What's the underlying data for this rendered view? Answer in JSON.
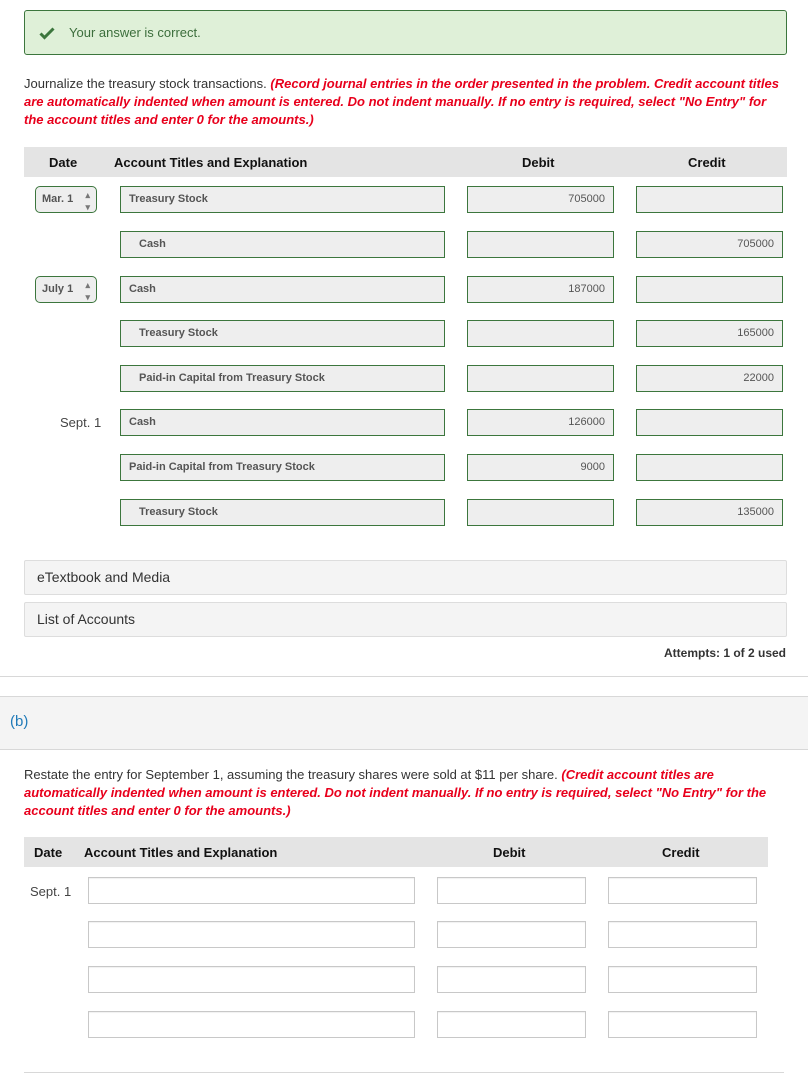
{
  "alert": {
    "icon": "check-icon",
    "message": "Your answer is correct."
  },
  "part_a": {
    "instruction": "Journalize the treasury stock transactions.",
    "instruction_red": "(Record journal entries in the order presented in the problem. Credit account titles are automatically indented when amount is entered. Do not indent manually. If no entry is required, select \"No Entry\" for the account titles and enter 0 for the amounts.)",
    "headers": {
      "date": "Date",
      "account": "Account Titles and Explanation",
      "debit": "Debit",
      "credit": "Credit"
    },
    "rows": [
      {
        "date": "Mar. 1",
        "date_type": "select",
        "account": "Treasury Stock",
        "indent": false,
        "debit": "705000",
        "credit": ""
      },
      {
        "date": "",
        "account": "Cash",
        "indent": true,
        "debit": "",
        "credit": "705000"
      },
      {
        "date": "July 1",
        "date_type": "select",
        "account": "Cash",
        "indent": false,
        "debit": "187000",
        "credit": ""
      },
      {
        "date": "",
        "account": "Treasury Stock",
        "indent": true,
        "debit": "",
        "credit": "165000"
      },
      {
        "date": "",
        "account": "Paid-in Capital from Treasury Stock",
        "indent": true,
        "debit": "",
        "credit": "22000"
      },
      {
        "date": "Sept. 1",
        "date_type": "label",
        "account": "Cash",
        "indent": false,
        "debit": "126000",
        "credit": ""
      },
      {
        "date": "",
        "account": "Paid-in Capital from Treasury Stock",
        "indent": false,
        "debit": "9000",
        "credit": ""
      },
      {
        "date": "",
        "account": "Treasury Stock",
        "indent": true,
        "debit": "",
        "credit": "135000"
      }
    ],
    "etextbook_label": "eTextbook and Media",
    "list_accounts_label": "List of Accounts",
    "attempts": "Attempts: 1 of 2 used"
  },
  "part_b": {
    "label": "(b)",
    "instruction": "Restate the entry for September 1, assuming the treasury shares were sold at $11 per share.",
    "instruction_red": "(Credit account titles are automatically indented when amount is entered. Do not indent manually. If no entry is required, select \"No Entry\" for the account titles and enter 0 for the amounts.)",
    "headers": {
      "date": "Date",
      "account": "Account Titles and Explanation",
      "debit": "Debit",
      "credit": "Credit"
    },
    "date": "Sept. 1",
    "rows": [
      {
        "account": "",
        "debit": "",
        "credit": ""
      },
      {
        "account": "",
        "debit": "",
        "credit": ""
      },
      {
        "account": "",
        "debit": "",
        "credit": ""
      },
      {
        "account": "",
        "debit": "",
        "credit": ""
      }
    ]
  },
  "colors": {
    "success_bg": "#dff0d8",
    "success_border": "#3c763d",
    "warning_red": "#e8001c",
    "part_label_blue": "#1f7ab8"
  }
}
